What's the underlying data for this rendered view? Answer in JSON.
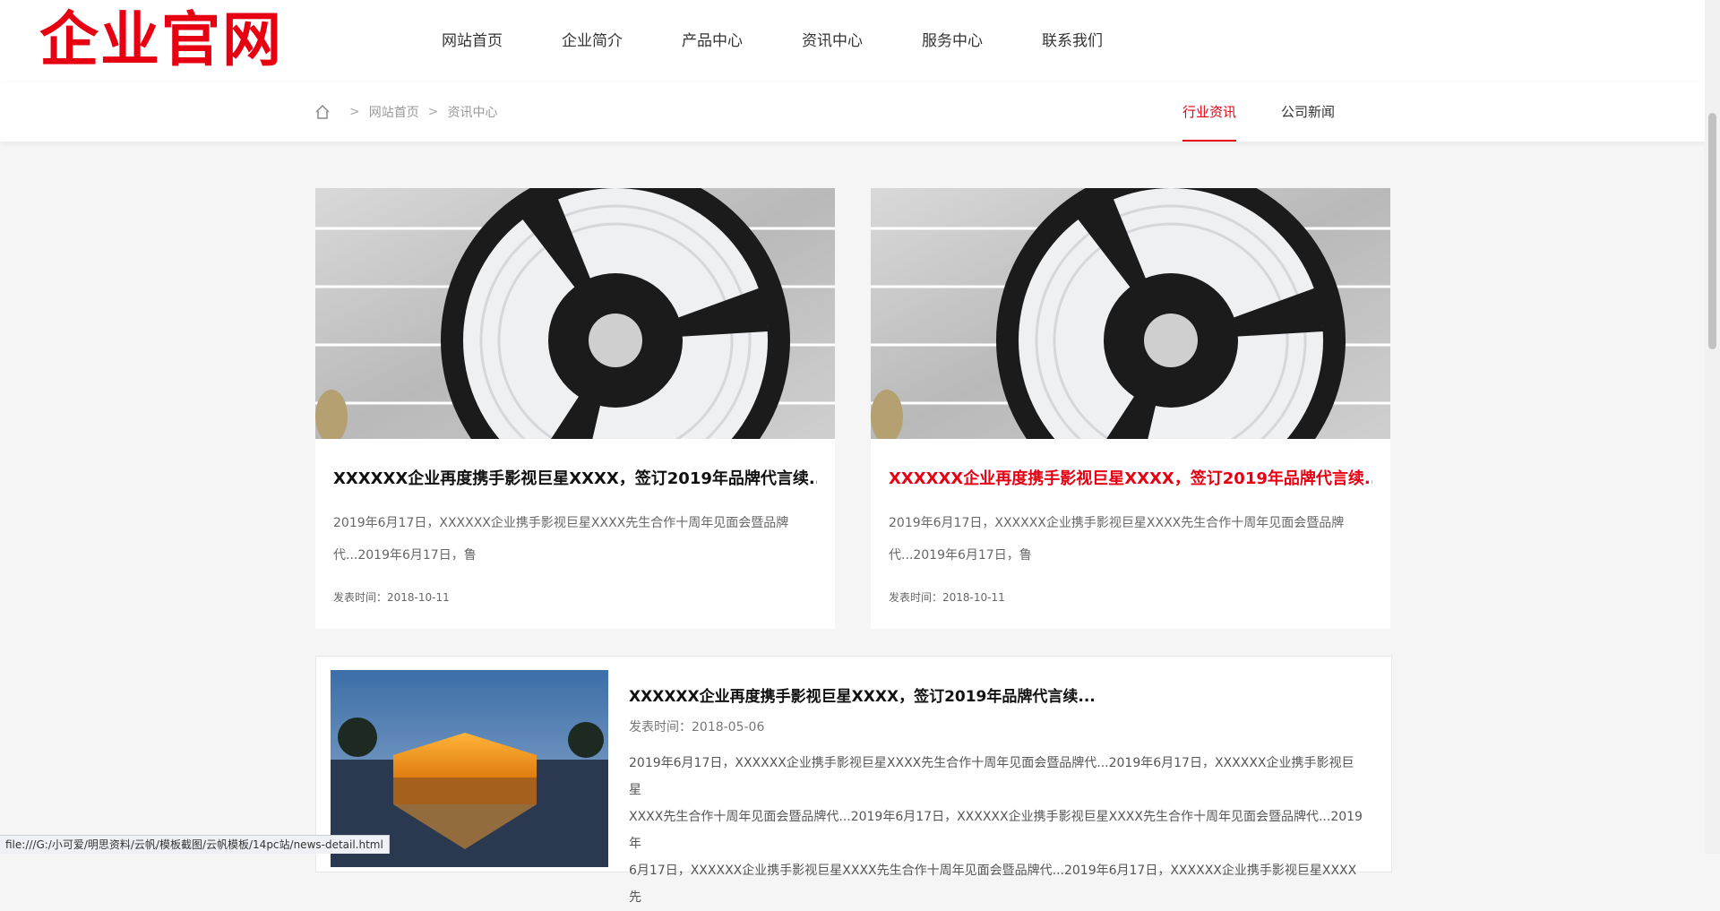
{
  "brand": {
    "logo_text": "企业官网",
    "accent_color": "#e60012"
  },
  "nav": {
    "items": [
      {
        "label": "网站首页"
      },
      {
        "label": "企业简介"
      },
      {
        "label": "产品中心"
      },
      {
        "label": "资讯中心"
      },
      {
        "label": "服务中心"
      },
      {
        "label": "联系我们"
      }
    ]
  },
  "breadcrumb": {
    "home_icon": "home-icon",
    "items": [
      {
        "label": "网站首页"
      },
      {
        "label": "资讯中心"
      }
    ]
  },
  "subnav": {
    "items": [
      {
        "label": "行业资讯",
        "active": true
      },
      {
        "label": "公司新闻",
        "active": false
      }
    ]
  },
  "cards": [
    {
      "title": "XXXXXX企业再度携手影视巨星XXXX，签订2019年品牌代言续...",
      "desc_line1": "2019年6月17日，XXXXXX企业携手影视巨星XXXX先生合作十周年见面会暨品牌",
      "desc_line2": "代...2019年6月17日，鲁",
      "date": "发表时间：2018-10-11"
    },
    {
      "title": "XXXXXX企业再度携手影视巨星XXXX，签订2019年品牌代言续...",
      "desc_line1": "2019年6月17日，XXXXXX企业携手影视巨星XXXX先生合作十周年见面会暨品牌",
      "desc_line2": "代...2019年6月17日，鲁",
      "date": "发表时间：2018-10-11"
    }
  ],
  "list": {
    "items": [
      {
        "title": "XXXXXX企业再度携手影视巨星XXXX，签订2019年品牌代言续...",
        "date": "发表时间：2018-05-06",
        "desc_line1": "2019年6月17日，XXXXXX企业携手影视巨星XXXX先生合作十周年见面会暨品牌代...2019年6月17日，XXXXXX企业携手影视巨星",
        "desc_line2": "XXXX先生合作十周年见面会暨品牌代...2019年6月17日，XXXXXX企业携手影视巨星XXXX先生合作十周年见面会暨品牌代...2019年",
        "desc_line3": "6月17日，XXXXXX企业携手影视巨星XXXX先生合作十周年见面会暨品牌代...2019年6月17日，XXXXXX企业携手影视巨星XXXX先"
      }
    ]
  },
  "status_url": "file:///G:/小可爱/明思资料/云帆/模板截图/云帆模板/14pc站/news-detail.html"
}
